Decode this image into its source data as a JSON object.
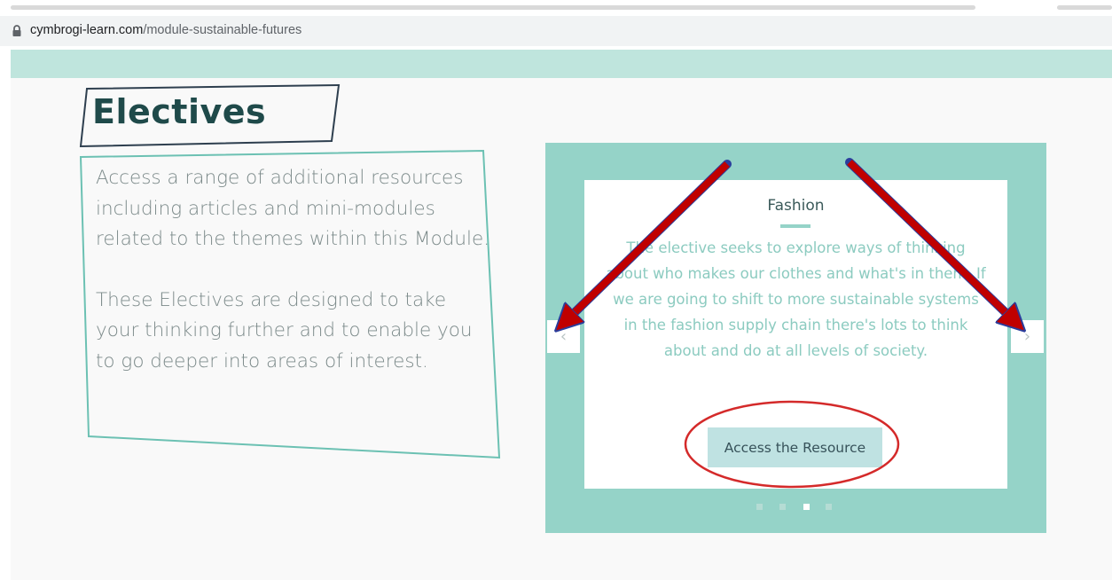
{
  "browser": {
    "url_domain": "cymbrogi-learn.com",
    "url_path": "/module-sustainable-futures"
  },
  "page": {
    "title": "Electives",
    "description": [
      "Access a range of additional resources including articles and mini-modules related to the themes within this Module.",
      "These Electives are designed to take your thinking further and to enable you to go deeper into areas of interest."
    ]
  },
  "carousel": {
    "card_title": "Fashion",
    "card_text": "The elective seeks to explore ways of thinking about who makes our clothes and what's in them. If we are going to shift to more sustainable systems in the fashion supply chain there's lots to think about and do at all levels of society.",
    "button_label": "Access the Resource",
    "prev_glyph": "‹",
    "next_glyph": "›",
    "slide_count": 4,
    "active_slide": 3
  },
  "colors": {
    "accent_teal": "#95d3c8",
    "banner": "#bfe5dd",
    "heading": "#1f4a4a",
    "annotation_arrow": "#c00000",
    "annotation_circle": "#d42a2a"
  },
  "icons": {
    "address_bar": "lock-icon",
    "carousel_prev": "chevron-left-icon",
    "carousel_next": "chevron-right-icon"
  }
}
